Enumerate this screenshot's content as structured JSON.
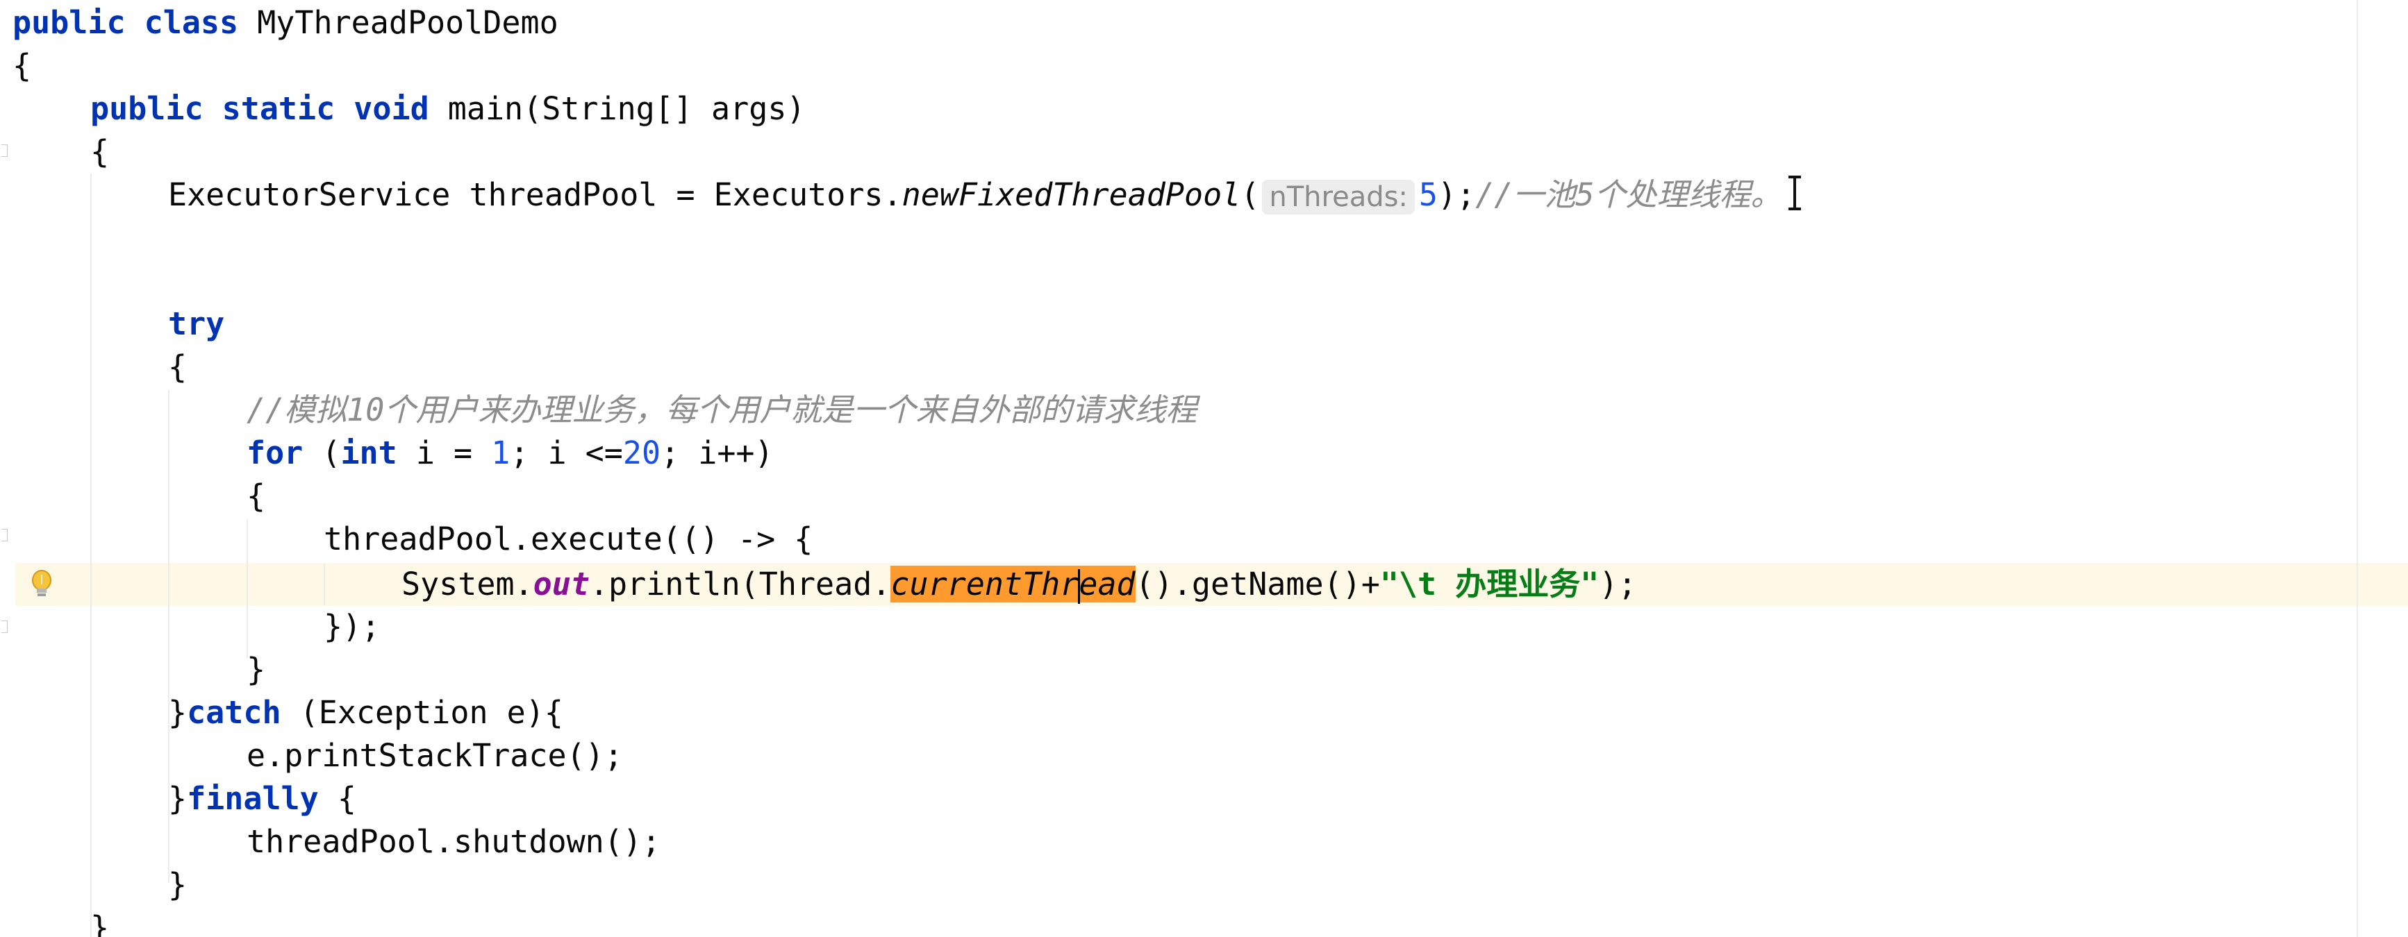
{
  "editor": {
    "lines": [
      {
        "kw": "public class",
        "rest": " MyThreadPoolDemo"
      },
      {
        "text": "{"
      },
      {
        "kw": "public static void",
        "rest": " main(String[] args)"
      },
      {
        "text": "{"
      },
      {
        "pre": "ExecutorService threadPool = Executors.",
        "method": "newFixedThreadPool",
        "open": "(",
        "hint": "nThreads:",
        "num": "5",
        "post": ");",
        "comment": "//一池5个处理线程。"
      },
      {
        "kw": "try"
      },
      {
        "text": "{"
      },
      {
        "comment": "//模拟10个用户来办理业务，每个用户就是一个来自外部的请求线程"
      },
      {
        "kw1": "for",
        "p1": " (",
        "kw2": "int",
        "p2": " i = ",
        "num1": "1",
        "p3": "; i <=",
        "num2": "20",
        "p4": "; i++)"
      },
      {
        "text": "{"
      },
      {
        "text": "threadPool.execute(() -> {"
      },
      {
        "pre": "System.",
        "field": "out",
        "mid": ".println(Thread.",
        "hl_a": "currentThr",
        "hl_b": "ead",
        "post": "().getName()+",
        "str": "\"\\t 办理业务\"",
        "end": ");"
      },
      {
        "text": "});"
      },
      {
        "text": "}"
      },
      {
        "brace": "}",
        "kw": "catch",
        "rest": " (Exception e){"
      },
      {
        "text": "e.printStackTrace();"
      },
      {
        "brace": "}",
        "kw": "finally",
        "rest": " {"
      },
      {
        "text": "threadPool.shutdown();"
      },
      {
        "text": "}"
      },
      {
        "text": "}"
      }
    ]
  },
  "icons": {
    "intention": "lightbulb-icon",
    "cursor": "text-cursor-icon"
  },
  "colors": {
    "keyword": "#0033b3",
    "number": "#1750eb",
    "comment": "#8c8c8c",
    "string": "#067d17",
    "static_field": "#871094",
    "highlight": "#ff9a2e",
    "caret_row": "#fdf9e6"
  }
}
